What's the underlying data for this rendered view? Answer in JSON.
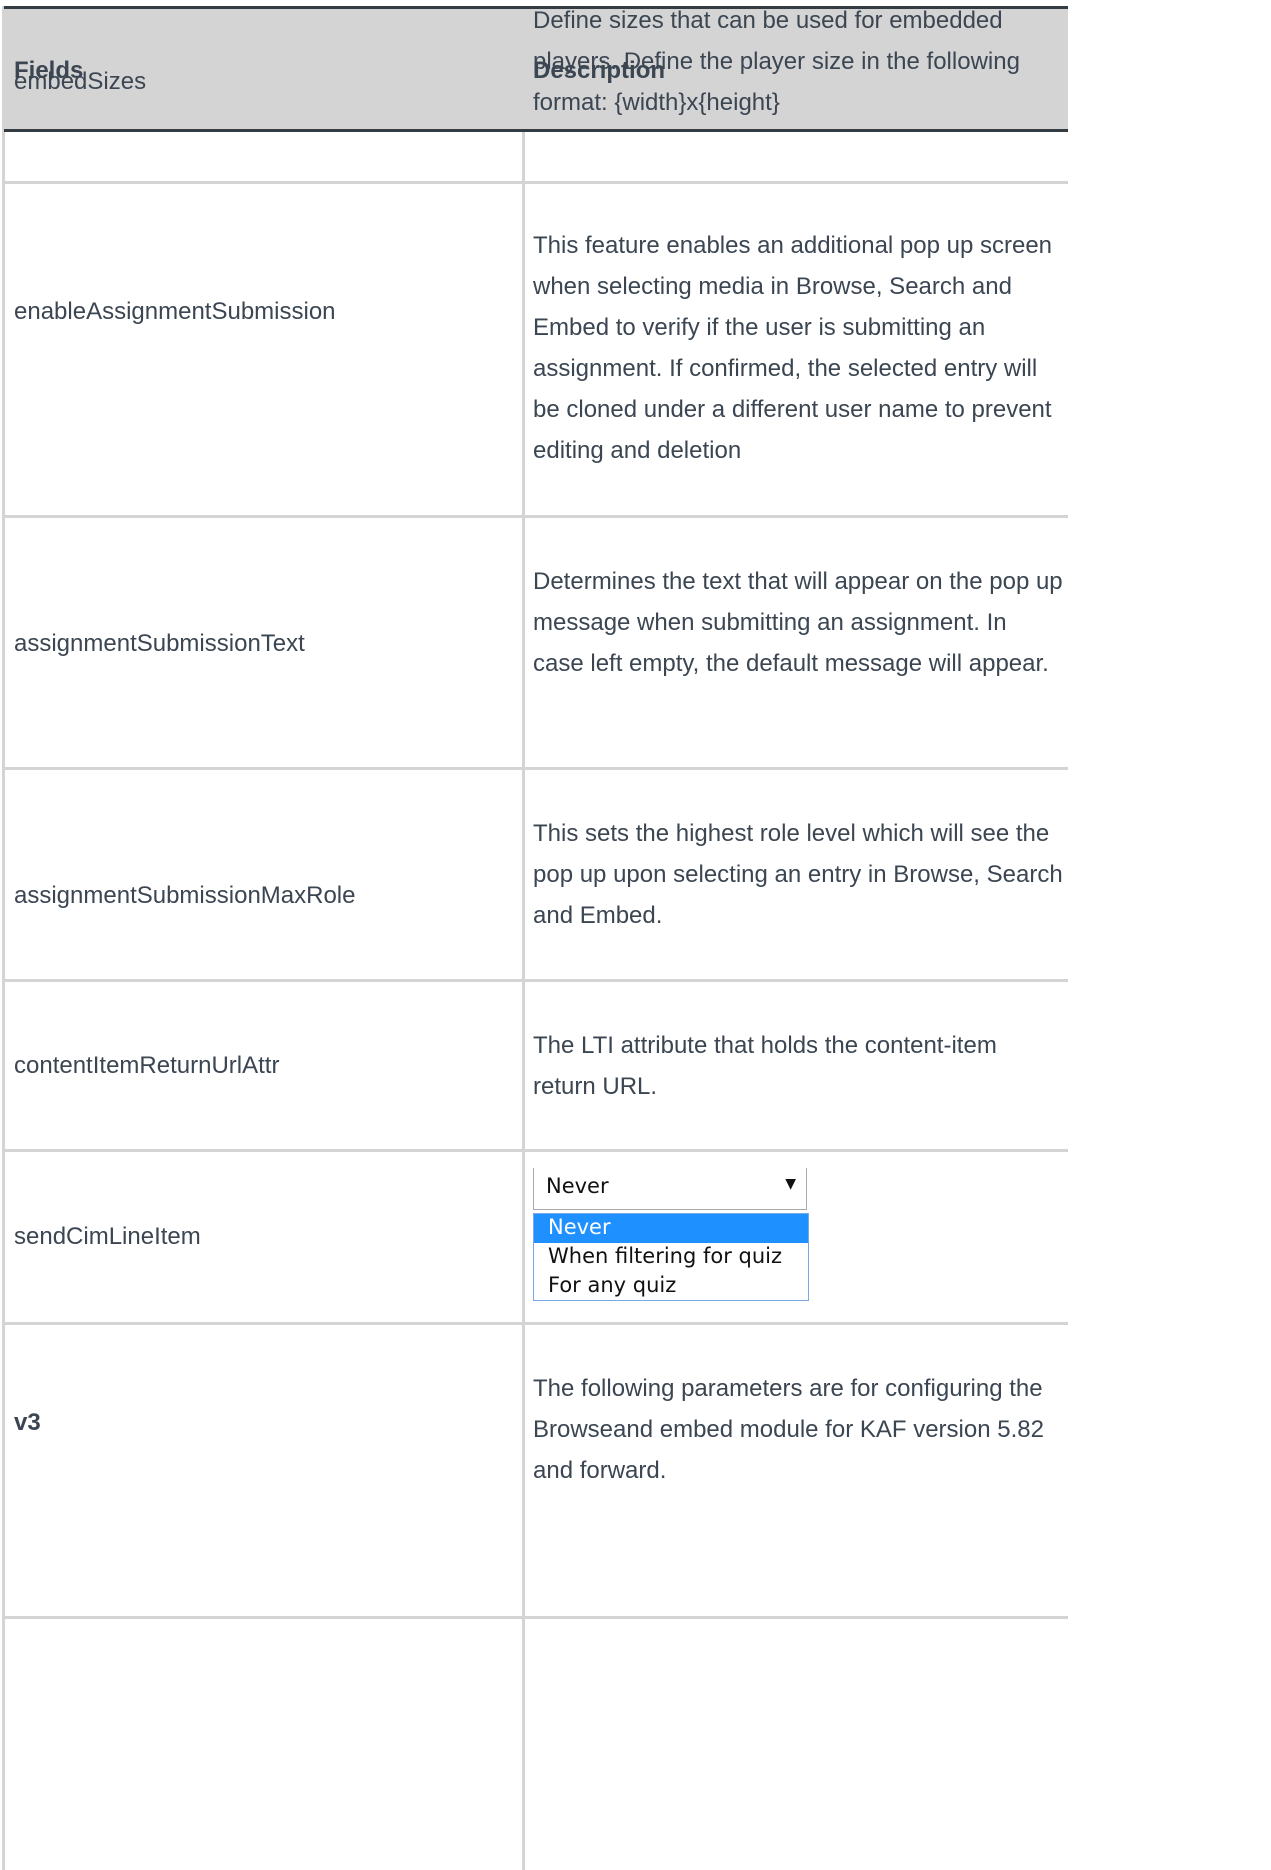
{
  "table": {
    "header": {
      "col1": "Fields",
      "col2": "Description",
      "overlay_field": "embedSizes",
      "overlay_desc": "Define sizes that can be used for embedded players. Define the player size in the following format: {width}x{height}"
    },
    "rows": [
      {
        "field": "enableAssignmentSubmission",
        "desc": "This feature enables an additional pop up screen when selecting media in Browse, Search and Embed to verify if the user is submitting an assignment. If confirmed, the selected entry will be cloned under a different user name to prevent editing and deletion"
      },
      {
        "field": "assignmentSubmissionText",
        "desc": "Determines the text that will appear on the pop up message when submitting an assignment. In case left empty, the default message will appear."
      },
      {
        "field": "assignmentSubmissionMaxRole",
        "desc": "This sets the highest role level which will see the pop up upon selecting an entry in Browse, Search and Embed."
      },
      {
        "field": "contentItemReturnUrlAttr",
        "desc": "The LTI attribute that holds the content-item return URL."
      },
      {
        "field": "sendCimLineItem",
        "desc": ""
      },
      {
        "field": "v3",
        "desc": "The following parameters are for configuring the Browseand embed module for KAF version 5.82 and forward."
      }
    ]
  },
  "dropdown": {
    "selected": "Never",
    "options": [
      "Never",
      "When filtering for quiz",
      "For any quiz"
    ]
  }
}
